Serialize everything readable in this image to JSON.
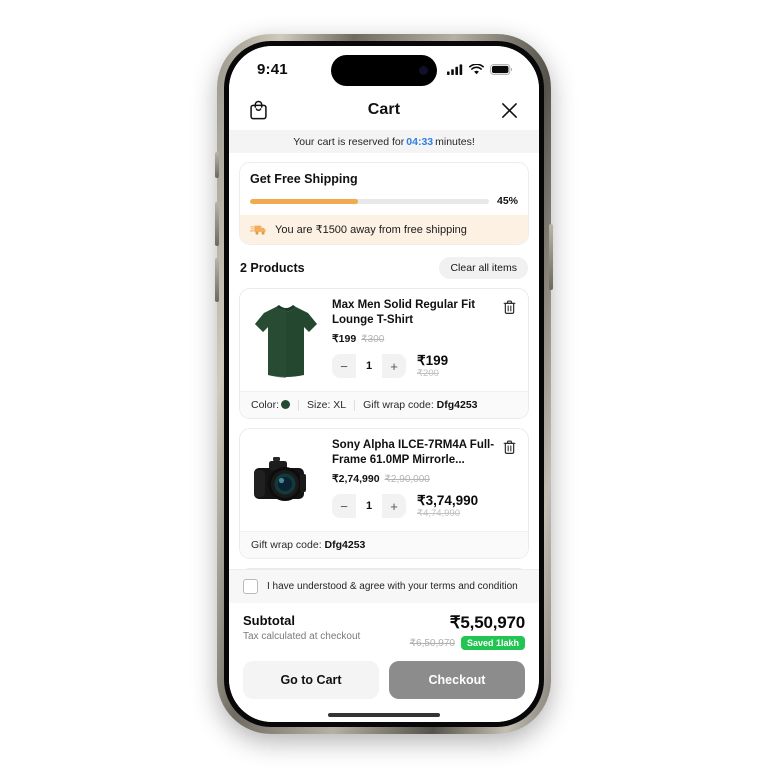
{
  "status_bar": {
    "time": "9:41",
    "signal_icon": "cellular-signal-icon",
    "wifi_icon": "wifi-icon",
    "battery_icon": "battery-icon"
  },
  "header": {
    "bag_icon": "shopping-bag-icon",
    "title": "Cart",
    "close_icon": "close-icon"
  },
  "reservation": {
    "prefix": "Your cart is reserved for",
    "timer": "04:33",
    "suffix": "minutes!"
  },
  "shipping": {
    "title": "Get Free Shipping",
    "percent_label": "45%",
    "percent_value": 45,
    "truck_icon": "delivery-truck-icon",
    "banner_text": "You are ₹1500 away from free shipping",
    "fill_color": "#f4a84f",
    "banner_bg": "#fdf1e4"
  },
  "products_header": {
    "count_label": "2 Products",
    "clear_label": "Clear all items"
  },
  "products": [
    {
      "image_icon": "tshirt-image",
      "name": "Max Men Solid Regular Fit Lounge T-Shirt",
      "price": "₹199",
      "price_strike": "₹300",
      "quantity": "1",
      "minus_label": "−",
      "plus_label": "+",
      "line_total": "₹199",
      "line_total_strike": "₹200",
      "delete_icon": "trash-icon",
      "attributes": {
        "color_label": "Color:",
        "color_value": "#234b32",
        "size_label": "Size:",
        "size_value": "XL",
        "gift_label": "Gift wrap code:",
        "gift_value": "Dfg4253"
      }
    },
    {
      "image_icon": "camera-image",
      "name": "Sony Alpha ILCE-7RM4A Full-Frame 61.0MP Mirrorle...",
      "price": "₹2,74,990",
      "price_strike": "₹2,90,000",
      "quantity": "1",
      "minus_label": "−",
      "plus_label": "+",
      "line_total": "₹3,74,990",
      "line_total_strike": "₹4,74,990",
      "delete_icon": "trash-icon",
      "attributes": {
        "gift_label": "Gift wrap code:",
        "gift_value": "Dfg4253"
      }
    }
  ],
  "terms": {
    "text": "I have understood & agree with your terms and condition",
    "checked": false
  },
  "summary": {
    "subtotal_label": "Subtotal",
    "tax_note": "Tax calculated at checkout",
    "total": "₹5,50,970",
    "total_strike": "₹6,50,970",
    "saved_badge": "Saved 1lakh",
    "saved_color": "#23c552"
  },
  "actions": {
    "secondary_label": "Go to Cart",
    "primary_label": "Checkout"
  }
}
